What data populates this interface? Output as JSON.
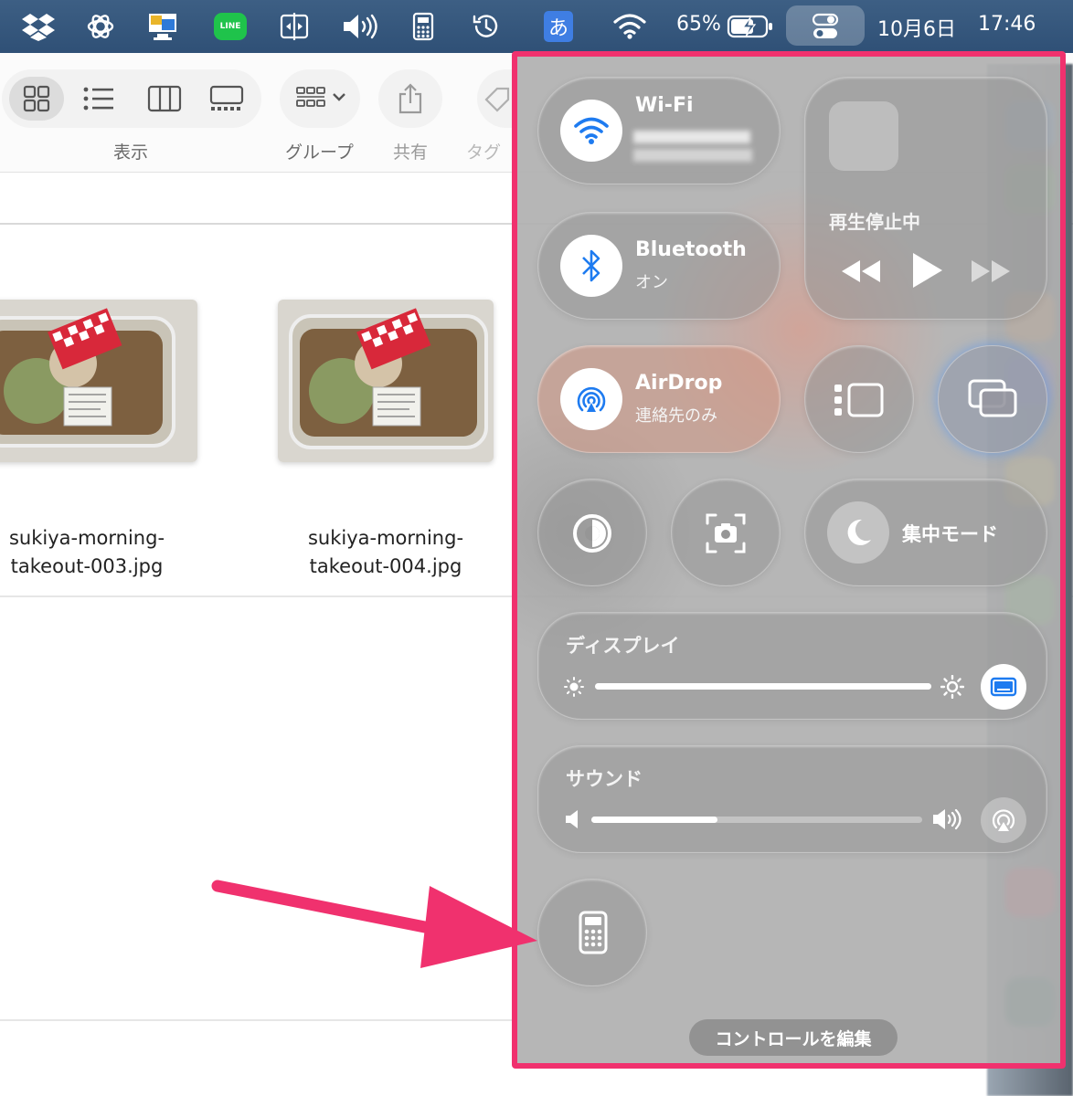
{
  "menubar": {
    "battery_percent": "65%",
    "ime_label": "あ",
    "line_label": "LINE",
    "date": "10月6日",
    "time": "17:46"
  },
  "finder": {
    "toolbar": {
      "view_label": "表示",
      "group_label": "グループ",
      "share_label": "共有",
      "tag_label": "タグ"
    },
    "files": [
      {
        "line1": "sukiya-morning-",
        "line2": "takeout-003.jpg"
      },
      {
        "line1": "sukiya-morning-",
        "line2": "takeout-004.jpg"
      }
    ]
  },
  "control_center": {
    "wifi": {
      "title": "Wi-Fi"
    },
    "bluetooth": {
      "title": "Bluetooth",
      "status": "オン"
    },
    "airdrop": {
      "title": "AirDrop",
      "status": "連絡先のみ"
    },
    "now_playing": {
      "status": "再生停止中"
    },
    "focus": {
      "title": "集中モード"
    },
    "display": {
      "title": "ディスプレイ",
      "level": 1.0
    },
    "sound": {
      "title": "サウンド",
      "level": 0.38
    },
    "edit_label": "コントロールを編集"
  },
  "colors": {
    "highlight_border": "#f0316e",
    "arrow": "#f0316e",
    "accent_blue": "#1e7bf0",
    "menubar": "#355a80"
  }
}
